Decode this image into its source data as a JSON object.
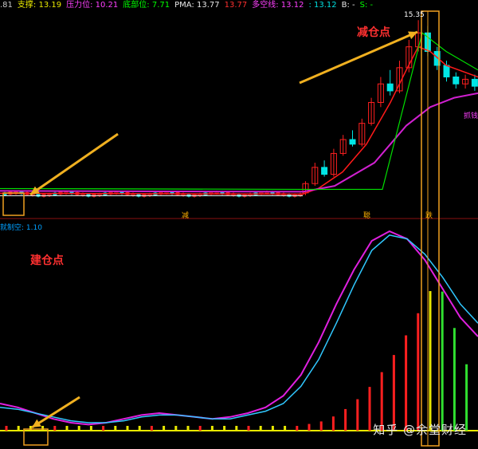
{
  "header": {
    "items": [
      {
        "text": ".81",
        "color": "#c8c8c8"
      },
      {
        "text": "支撑: 13.19",
        "color": "#e8e800"
      },
      {
        "text": "压力位: 10.21",
        "color": "#ff40ff"
      },
      {
        "text": "底部位: 7.71",
        "color": "#00ff00"
      },
      {
        "text": "PMA: 13.77",
        "color": "#e8e8e8"
      },
      {
        "text": "13.77",
        "color": "#ff3030"
      },
      {
        "text": "多空线: 13.12",
        "color": "#ff40ff"
      },
      {
        "text": ": 13.12",
        "color": "#00e0e0"
      },
      {
        "text": "B: -",
        "color": "#e8e8e8"
      },
      {
        "text": "S: -",
        "color": "#00ff00"
      }
    ]
  },
  "annotations": {
    "reduce_point": "减仓点",
    "build_point": "建仓点",
    "peak_price": "15.35",
    "buy_signal": "抓钱",
    "top_label": "减",
    "mid_label": "聪",
    "jump_label": "跌",
    "indicator_label": "就制空: 1.10"
  },
  "watermark": "知乎 @余堂财经",
  "colors": {
    "up": "#ff2020",
    "down": "#00e5e5",
    "ma_fast": "#ff1a1a",
    "ma_mid": "#00e000",
    "ma_slow": "#d020d0",
    "arrow": "#f0b020",
    "box": "#f0a020",
    "baseline": "#e8e800"
  },
  "chart_data": [
    {
      "type": "candlestick",
      "title": "",
      "peak_label": "15.35",
      "candles_tail": [
        {
          "o": 7.9,
          "c": 8.3,
          "h": 8.4,
          "l": 7.8
        },
        {
          "o": 8.3,
          "c": 9.0,
          "h": 9.2,
          "l": 8.2
        },
        {
          "o": 9.0,
          "c": 8.7,
          "h": 9.3,
          "l": 8.6
        },
        {
          "o": 8.7,
          "c": 9.6,
          "h": 9.8,
          "l": 8.6
        },
        {
          "o": 9.6,
          "c": 10.2,
          "h": 10.4,
          "l": 9.5
        },
        {
          "o": 10.2,
          "c": 10.0,
          "h": 10.6,
          "l": 9.9
        },
        {
          "o": 10.0,
          "c": 10.9,
          "h": 11.1,
          "l": 9.9
        },
        {
          "o": 10.9,
          "c": 11.8,
          "h": 12.0,
          "l": 10.8
        },
        {
          "o": 11.8,
          "c": 12.6,
          "h": 12.9,
          "l": 11.6
        },
        {
          "o": 12.6,
          "c": 12.3,
          "h": 13.2,
          "l": 12.1
        },
        {
          "o": 12.3,
          "c": 13.3,
          "h": 13.6,
          "l": 12.2
        },
        {
          "o": 13.3,
          "c": 14.2,
          "h": 14.5,
          "l": 13.1
        },
        {
          "o": 14.2,
          "c": 14.8,
          "h": 15.35,
          "l": 14.0
        },
        {
          "o": 14.8,
          "c": 14.0,
          "h": 15.1,
          "l": 13.8
        },
        {
          "o": 14.0,
          "c": 13.4,
          "h": 14.2,
          "l": 13.2
        },
        {
          "o": 13.4,
          "c": 12.9,
          "h": 13.6,
          "l": 12.7
        },
        {
          "o": 12.9,
          "c": 12.6,
          "h": 13.1,
          "l": 12.4
        },
        {
          "o": 12.6,
          "c": 12.8,
          "h": 13.0,
          "l": 12.4
        },
        {
          "o": 12.8,
          "c": 12.5,
          "h": 13.0,
          "l": 12.3
        }
      ]
    },
    {
      "type": "line",
      "title": "",
      "series": [
        {
          "values": [
            0.1,
            0.08,
            0.05,
            0.02,
            0.0,
            -0.01,
            0.0,
            0.02,
            0.04,
            0.05,
            0.04,
            0.03,
            0.02,
            0.03,
            0.05,
            0.08,
            0.14,
            0.25,
            0.42,
            0.62,
            0.8,
            0.95,
            1.0,
            0.96,
            0.85,
            0.7,
            0.55,
            0.45
          ]
        },
        {
          "values": [
            0.08,
            0.07,
            0.05,
            0.03,
            0.01,
            0.0,
            0.0,
            0.01,
            0.03,
            0.04,
            0.04,
            0.03,
            0.02,
            0.02,
            0.04,
            0.06,
            0.1,
            0.19,
            0.33,
            0.52,
            0.72,
            0.9,
            0.98,
            0.96,
            0.88,
            0.76,
            0.62,
            0.52
          ]
        }
      ]
    }
  ]
}
